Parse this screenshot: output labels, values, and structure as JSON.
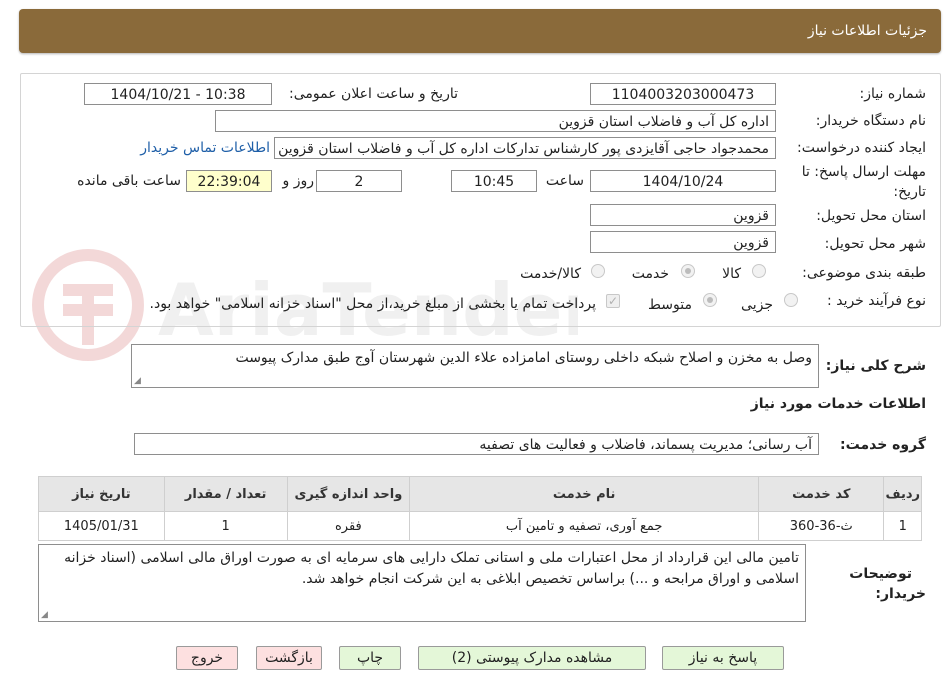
{
  "header": {
    "title": "جزئیات اطلاعات نیاز"
  },
  "form": {
    "need_number": {
      "label": "شماره نیاز:",
      "value": "1104003203000473"
    },
    "announce_datetime": {
      "label": "تاریخ و ساعت اعلان عمومی:",
      "value": "1404/10/21 - 10:38"
    },
    "buyer_org": {
      "label": "نام دستگاه خریدار:",
      "value": "اداره کل آب و فاضلاب استان قزوین"
    },
    "requester": {
      "label": "ایجاد کننده درخواست:",
      "value": "محمدجواد حاجی آقایزدی پور کارشناس تدارکات اداره کل آب و فاضلاب استان قزوین",
      "contact_link": "اطلاعات تماس خریدار"
    },
    "deadline": {
      "label_line1": "مهلت ارسال پاسخ: تا",
      "label_line2": "تاریخ:",
      "date": "1404/10/24",
      "time_label": "ساعت",
      "time": "10:45",
      "days": "2",
      "days_label": "روز و",
      "remaining": "22:39:04",
      "remaining_label": "ساعت باقی مانده"
    },
    "province": {
      "label": "استان محل تحویل:",
      "value": "قزوین"
    },
    "city": {
      "label": "شهر محل تحویل:",
      "value": "قزوین"
    },
    "category": {
      "label": "طبقه بندی موضوعی:",
      "options": [
        "کالا",
        "خدمت",
        "کالا/خدمت"
      ],
      "selected": "خدمت"
    },
    "purchase_process": {
      "label": "نوع فرآیند خرید :",
      "options": [
        "جزیی",
        "متوسط"
      ],
      "selected": "متوسط",
      "payment_note": "پرداخت تمام یا بخشی از مبلغ خرید،از محل \"اسناد خزانه اسلامی\" خواهد بود."
    }
  },
  "summary": {
    "label": "شرح کلی نیاز:",
    "value": "وصل به مخزن و اصلاح شبکه داخلی روستای امامزاده علاء الدین شهرستان آوج طبق مدارک پیوست"
  },
  "services_section": {
    "title": "اطلاعات خدمات مورد نیاز"
  },
  "service_group": {
    "label": "گروه خدمت:",
    "value": "آب رسانی؛ مدیریت پسماند، فاضلاب و فعالیت های تصفیه"
  },
  "table": {
    "columns": [
      "ردیف",
      "کد خدمت",
      "نام خدمت",
      "واحد اندازه گیری",
      "تعداد / مقدار",
      "تاریخ نیاز"
    ],
    "rows": [
      [
        "1",
        "ث-36-360",
        "جمع آوری، تصفیه و تامین آب",
        "فقره",
        "1",
        "1405/01/31"
      ]
    ]
  },
  "buyer_notes": {
    "label_line1": "توضیحات",
    "label_line2": "خریدار:",
    "value": "تامین مالی این قرارداد از محل اعتبارات ملی و استانی تملک دارایی های سرمایه ای به صورت اوراق مالی اسلامی (اسناد خزانه اسلامی و اوراق مرابحه و ...) براساس تخصیص ابلاغی به این شرکت انجام خواهد شد."
  },
  "buttons": {
    "respond": "پاسخ به نیاز",
    "view_docs": "مشاهده مدارک پیوستی (2)",
    "print": "چاپ",
    "back": "بازگشت",
    "exit": "خروج"
  },
  "watermark": {
    "text": "AriaTender.neT"
  },
  "colors": {
    "header_bg": "#8a6a3a",
    "link": "#1f5fa8",
    "remaining_bg": "#ffffcc",
    "green_btn": "#e4f7d8",
    "pink_btn": "#fde0e0"
  }
}
